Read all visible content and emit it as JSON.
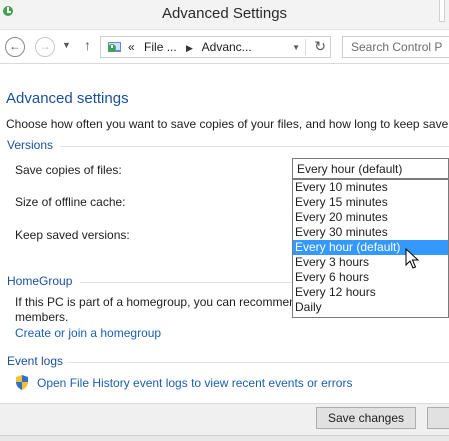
{
  "window": {
    "title": "Advanced Settings",
    "icon": "control-panel-icon"
  },
  "navbar": {
    "back_icon": "arrow-left-icon",
    "forward_icon": "arrow-right-icon",
    "up_icon": "arrow-up-icon",
    "address": {
      "overflow": "«",
      "crumbs": [
        "File ...",
        "Advanc..."
      ],
      "separator": "▶"
    },
    "search_placeholder": "Search Control P"
  },
  "page": {
    "title": "Advanced settings",
    "description": "Choose how often you want to save copies of your files, and how long to keep save"
  },
  "sections": {
    "versions": {
      "heading": "Versions",
      "save_copies_label": "Save copies of files:",
      "cache_label": "Size of offline cache:",
      "keep_versions_label": "Keep saved versions:"
    },
    "homegroup": {
      "heading": "HomeGroup",
      "text_line1": "If this PC is part of a homegroup, you can recommen",
      "text_line2": "members.",
      "link": "Create or join a homegroup"
    },
    "event_logs": {
      "heading": "Event logs",
      "link": "Open File History event logs to view recent events or errors",
      "icon": "shield-icon"
    }
  },
  "save_copies_select": {
    "value": "Every hour (default)",
    "options": [
      "Every 10 minutes",
      "Every 15 minutes",
      "Every 20 minutes",
      "Every 30 minutes",
      "Every hour (default)",
      "Every 3 hours",
      "Every 6 hours",
      "Every 12 hours",
      "Daily"
    ],
    "highlighted": "Every hour (default)"
  },
  "footer": {
    "save_label": "Save changes"
  },
  "colors": {
    "heading_blue": "#1a4f9c",
    "link_blue": "#1a5fb4",
    "selection": "#3399ff"
  }
}
